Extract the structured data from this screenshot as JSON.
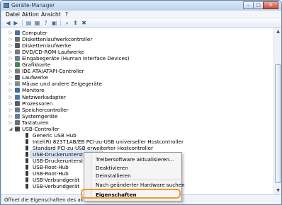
{
  "window": {
    "title": "Geräte-Manager",
    "controls": {
      "minimize": "–",
      "maximize": "□",
      "close": "✕"
    }
  },
  "menubar": {
    "items": [
      "Datei",
      "Aktion",
      "Ansicht",
      "?"
    ]
  },
  "toolbar": {
    "icons": [
      "back-arrow-icon",
      "forward-arrow-icon",
      "properties-icon",
      "show-hide-icon",
      "help-icon",
      "device-list-icon",
      "scan-hardware-icon",
      "update-driver-icon",
      "uninstall-icon"
    ]
  },
  "tree": {
    "items": [
      {
        "label": "Computer",
        "expander": "▷",
        "icon": "computer-icon"
      },
      {
        "label": "Diskettenlaufwerkcontroller",
        "expander": "▷",
        "icon": "floppy-controller-icon"
      },
      {
        "label": "Diskettenlaufwerke",
        "expander": "▷",
        "icon": "floppy-drive-icon"
      },
      {
        "label": "DVD/CD-ROM-Laufwerke",
        "expander": "▷",
        "icon": "dvd-drive-icon"
      },
      {
        "label": "Eingabegeräte (Human Interface Devices)",
        "expander": "▷",
        "icon": "hid-icon"
      },
      {
        "label": "Grafikkarte",
        "expander": "▷",
        "icon": "display-adapter-icon"
      },
      {
        "label": "IDE ATA/ATAPI-Controller",
        "expander": "▷",
        "icon": "ide-controller-icon"
      },
      {
        "label": "Laufwerke",
        "expander": "▷",
        "icon": "disk-drive-icon"
      },
      {
        "label": "Mäuse und andere Zeigegeräte",
        "expander": "▷",
        "icon": "mouse-icon"
      },
      {
        "label": "Monitore",
        "expander": "▷",
        "icon": "monitor-icon"
      },
      {
        "label": "Netzwerkadapter",
        "expander": "▷",
        "icon": "network-adapter-icon"
      },
      {
        "label": "Prozessoren",
        "expander": "▷",
        "icon": "processor-icon"
      },
      {
        "label": "Speichercontroller",
        "expander": "▷",
        "icon": "storage-controller-icon"
      },
      {
        "label": "Systemgeräte",
        "expander": "▷",
        "icon": "system-devices-icon"
      },
      {
        "label": "Tastaturen",
        "expander": "▷",
        "icon": "keyboard-icon"
      },
      {
        "label": "USB-Controller",
        "expander": "◢",
        "icon": "usb-controller-icon"
      },
      {
        "label": "Generic USB Hub",
        "expander": "",
        "icon": "usb-device-icon"
      },
      {
        "label": "Intel(R) 82371AB/EB PCI-zu-USB universeller Hostcontroller",
        "expander": "",
        "icon": "usb-device-icon"
      },
      {
        "label": "Standard PCI-zu-USB erweiterter Hostcontroller",
        "expander": "",
        "icon": "usb-device-icon"
      },
      {
        "label": "USB-Druckerunterstützung",
        "expander": "",
        "icon": "usb-device-icon",
        "selected": true
      },
      {
        "label": "USB-Druckerunterstützung",
        "expander": "",
        "icon": "usb-device-icon"
      },
      {
        "label": "USB-Root-Hub",
        "expander": "",
        "icon": "usb-device-icon"
      },
      {
        "label": "USB-Root-Hub",
        "expander": "",
        "icon": "usb-device-icon"
      },
      {
        "label": "USB-Verbundgerät",
        "expander": "",
        "icon": "usb-device-icon"
      },
      {
        "label": "USB-Verbundgerät",
        "expander": "",
        "icon": "usb-device-icon"
      }
    ]
  },
  "context_menu": {
    "items": [
      {
        "label": "Treibersoftware aktualisieren..."
      },
      {
        "label": "Deaktivieren"
      },
      {
        "label": "Deinstallieren"
      },
      {
        "label": "Nach geänderter Hardware suchen"
      },
      {
        "label": "Eigenschaften",
        "default": true,
        "highlighted": true
      }
    ]
  },
  "scrollbar": {
    "up": "▲",
    "down": "▼"
  },
  "statusbar": {
    "text": "Öffnet die Eigenschaften des aktuellen Ob"
  },
  "colors": {
    "highlight_ring": "#f39a2c",
    "selection": "#dde9f7"
  }
}
